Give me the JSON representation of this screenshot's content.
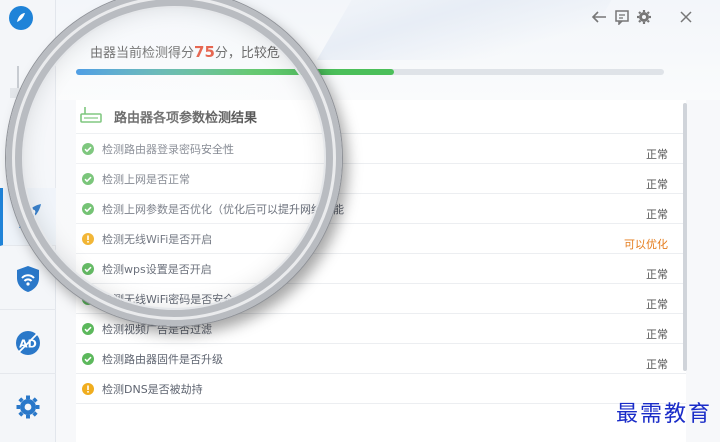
{
  "score": {
    "prefix": "由器当前检测得分",
    "value": "75",
    "suffix": "分，比较危",
    "progress_percent": 54
  },
  "panel": {
    "title": "路由器各项参数检测结果",
    "rows": [
      {
        "label": "检测路由器登录密码安全性",
        "status": "正常",
        "type": "ok"
      },
      {
        "label": "检测上网是否正常",
        "status": "正常",
        "type": "ok"
      },
      {
        "label": "检测上网参数是否优化（优化后可以提升网络性能",
        "status": "正常",
        "type": "ok"
      },
      {
        "label": "检测无线WiFi是否开启",
        "status": "可以优化",
        "type": "warn"
      },
      {
        "label": "检测wps设置是否开启",
        "status": "正常",
        "type": "ok"
      },
      {
        "label": "检测无线WiFi密码是否安全",
        "status": "正常",
        "type": "ok"
      },
      {
        "label": "检测视频广告是否过滤",
        "status": "正常",
        "type": "ok"
      },
      {
        "label": "检测路由器固件是否升级",
        "status": "正常",
        "type": "ok"
      },
      {
        "label": "检测DNS是否被劫持",
        "status": "",
        "type": "warn"
      }
    ]
  },
  "colors": {
    "ok": "#5cb85c",
    "warn": "#f0ad1e",
    "accent": "#1f83d8",
    "score": "#e0452b"
  },
  "sidebar": {
    "items": [
      {
        "name": "rocket-icon"
      },
      {
        "name": "shield-wifi-icon"
      },
      {
        "name": "ad-block-icon"
      },
      {
        "name": "gear-icon"
      }
    ]
  },
  "watermark": "最需教育"
}
